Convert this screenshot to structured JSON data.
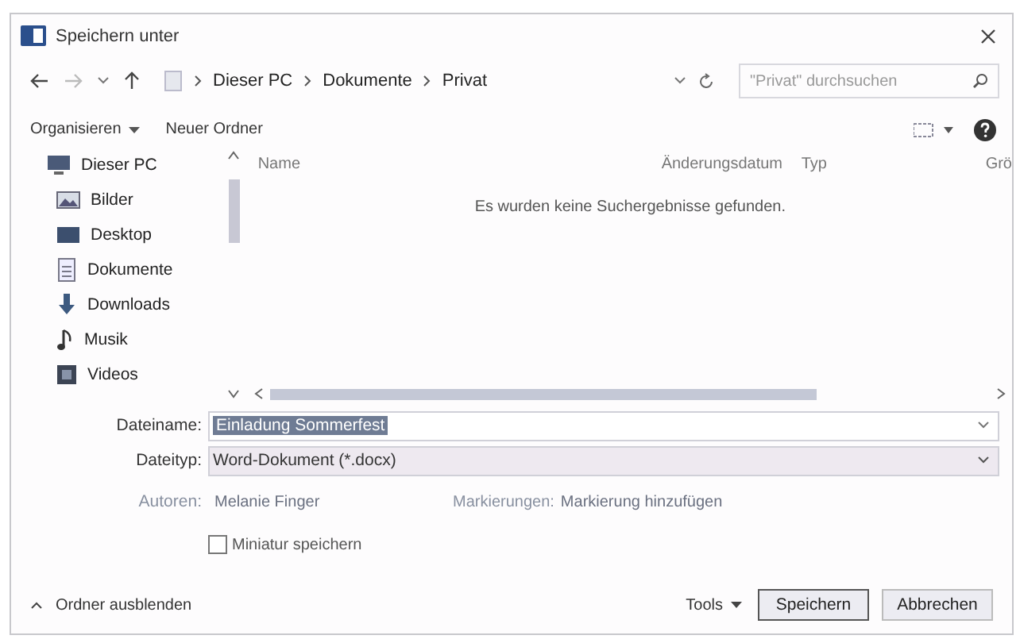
{
  "window": {
    "title": "Speichern unter"
  },
  "address": {
    "path": [
      "Dieser PC",
      "Dokumente",
      "Privat"
    ],
    "search_placeholder": "\"Privat\" durchsuchen"
  },
  "toolbar": {
    "organize": "Organisieren",
    "new_folder": "Neuer Ordner"
  },
  "sidebar": {
    "items": [
      {
        "label": "Dieser PC",
        "kind": "pc",
        "children": [
          {
            "label": "Bilder",
            "kind": "pictures"
          },
          {
            "label": "Desktop",
            "kind": "desktop"
          },
          {
            "label": "Dokumente",
            "kind": "documents"
          },
          {
            "label": "Downloads",
            "kind": "downloads"
          },
          {
            "label": "Musik",
            "kind": "music"
          },
          {
            "label": "Videos",
            "kind": "videos"
          }
        ]
      }
    ]
  },
  "file_list": {
    "columns": [
      "Name",
      "Änderungsdatum",
      "Typ",
      "Grö"
    ],
    "empty_message": "Es wurden keine Suchergebnisse gefunden."
  },
  "form": {
    "filename_label": "Dateiname:",
    "filename": {
      "value": "Einladung Sommerfest",
      "selected": true
    },
    "filetype_label": "Dateityp:",
    "filetype": "Word-Dokument (*.docx)",
    "authors_label": "Autoren:",
    "authors": "Melanie Finger",
    "tags_label": "Markierungen:",
    "tags": "Markierung hinzufügen",
    "thumbnail": {
      "label": "Miniatur speichern",
      "checked": false
    }
  },
  "footer": {
    "hide_folders": "Ordner ausblenden",
    "tools": "Tools",
    "save": "Speichern",
    "cancel": "Abbrechen"
  }
}
